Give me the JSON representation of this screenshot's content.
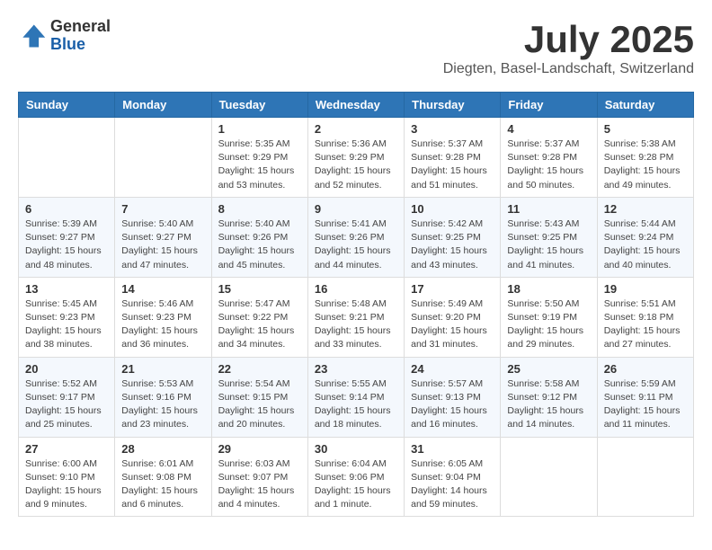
{
  "logo": {
    "general": "General",
    "blue": "Blue"
  },
  "title": "July 2025",
  "subtitle": "Diegten, Basel-Landschaft, Switzerland",
  "days_of_week": [
    "Sunday",
    "Monday",
    "Tuesday",
    "Wednesday",
    "Thursday",
    "Friday",
    "Saturday"
  ],
  "weeks": [
    [
      {
        "day": "",
        "detail": ""
      },
      {
        "day": "",
        "detail": ""
      },
      {
        "day": "1",
        "detail": "Sunrise: 5:35 AM\nSunset: 9:29 PM\nDaylight: 15 hours and 53 minutes."
      },
      {
        "day": "2",
        "detail": "Sunrise: 5:36 AM\nSunset: 9:29 PM\nDaylight: 15 hours and 52 minutes."
      },
      {
        "day": "3",
        "detail": "Sunrise: 5:37 AM\nSunset: 9:28 PM\nDaylight: 15 hours and 51 minutes."
      },
      {
        "day": "4",
        "detail": "Sunrise: 5:37 AM\nSunset: 9:28 PM\nDaylight: 15 hours and 50 minutes."
      },
      {
        "day": "5",
        "detail": "Sunrise: 5:38 AM\nSunset: 9:28 PM\nDaylight: 15 hours and 49 minutes."
      }
    ],
    [
      {
        "day": "6",
        "detail": "Sunrise: 5:39 AM\nSunset: 9:27 PM\nDaylight: 15 hours and 48 minutes."
      },
      {
        "day": "7",
        "detail": "Sunrise: 5:40 AM\nSunset: 9:27 PM\nDaylight: 15 hours and 47 minutes."
      },
      {
        "day": "8",
        "detail": "Sunrise: 5:40 AM\nSunset: 9:26 PM\nDaylight: 15 hours and 45 minutes."
      },
      {
        "day": "9",
        "detail": "Sunrise: 5:41 AM\nSunset: 9:26 PM\nDaylight: 15 hours and 44 minutes."
      },
      {
        "day": "10",
        "detail": "Sunrise: 5:42 AM\nSunset: 9:25 PM\nDaylight: 15 hours and 43 minutes."
      },
      {
        "day": "11",
        "detail": "Sunrise: 5:43 AM\nSunset: 9:25 PM\nDaylight: 15 hours and 41 minutes."
      },
      {
        "day": "12",
        "detail": "Sunrise: 5:44 AM\nSunset: 9:24 PM\nDaylight: 15 hours and 40 minutes."
      }
    ],
    [
      {
        "day": "13",
        "detail": "Sunrise: 5:45 AM\nSunset: 9:23 PM\nDaylight: 15 hours and 38 minutes."
      },
      {
        "day": "14",
        "detail": "Sunrise: 5:46 AM\nSunset: 9:23 PM\nDaylight: 15 hours and 36 minutes."
      },
      {
        "day": "15",
        "detail": "Sunrise: 5:47 AM\nSunset: 9:22 PM\nDaylight: 15 hours and 34 minutes."
      },
      {
        "day": "16",
        "detail": "Sunrise: 5:48 AM\nSunset: 9:21 PM\nDaylight: 15 hours and 33 minutes."
      },
      {
        "day": "17",
        "detail": "Sunrise: 5:49 AM\nSunset: 9:20 PM\nDaylight: 15 hours and 31 minutes."
      },
      {
        "day": "18",
        "detail": "Sunrise: 5:50 AM\nSunset: 9:19 PM\nDaylight: 15 hours and 29 minutes."
      },
      {
        "day": "19",
        "detail": "Sunrise: 5:51 AM\nSunset: 9:18 PM\nDaylight: 15 hours and 27 minutes."
      }
    ],
    [
      {
        "day": "20",
        "detail": "Sunrise: 5:52 AM\nSunset: 9:17 PM\nDaylight: 15 hours and 25 minutes."
      },
      {
        "day": "21",
        "detail": "Sunrise: 5:53 AM\nSunset: 9:16 PM\nDaylight: 15 hours and 23 minutes."
      },
      {
        "day": "22",
        "detail": "Sunrise: 5:54 AM\nSunset: 9:15 PM\nDaylight: 15 hours and 20 minutes."
      },
      {
        "day": "23",
        "detail": "Sunrise: 5:55 AM\nSunset: 9:14 PM\nDaylight: 15 hours and 18 minutes."
      },
      {
        "day": "24",
        "detail": "Sunrise: 5:57 AM\nSunset: 9:13 PM\nDaylight: 15 hours and 16 minutes."
      },
      {
        "day": "25",
        "detail": "Sunrise: 5:58 AM\nSunset: 9:12 PM\nDaylight: 15 hours and 14 minutes."
      },
      {
        "day": "26",
        "detail": "Sunrise: 5:59 AM\nSunset: 9:11 PM\nDaylight: 15 hours and 11 minutes."
      }
    ],
    [
      {
        "day": "27",
        "detail": "Sunrise: 6:00 AM\nSunset: 9:10 PM\nDaylight: 15 hours and 9 minutes."
      },
      {
        "day": "28",
        "detail": "Sunrise: 6:01 AM\nSunset: 9:08 PM\nDaylight: 15 hours and 6 minutes."
      },
      {
        "day": "29",
        "detail": "Sunrise: 6:03 AM\nSunset: 9:07 PM\nDaylight: 15 hours and 4 minutes."
      },
      {
        "day": "30",
        "detail": "Sunrise: 6:04 AM\nSunset: 9:06 PM\nDaylight: 15 hours and 1 minute."
      },
      {
        "day": "31",
        "detail": "Sunrise: 6:05 AM\nSunset: 9:04 PM\nDaylight: 14 hours and 59 minutes."
      },
      {
        "day": "",
        "detail": ""
      },
      {
        "day": "",
        "detail": ""
      }
    ]
  ]
}
